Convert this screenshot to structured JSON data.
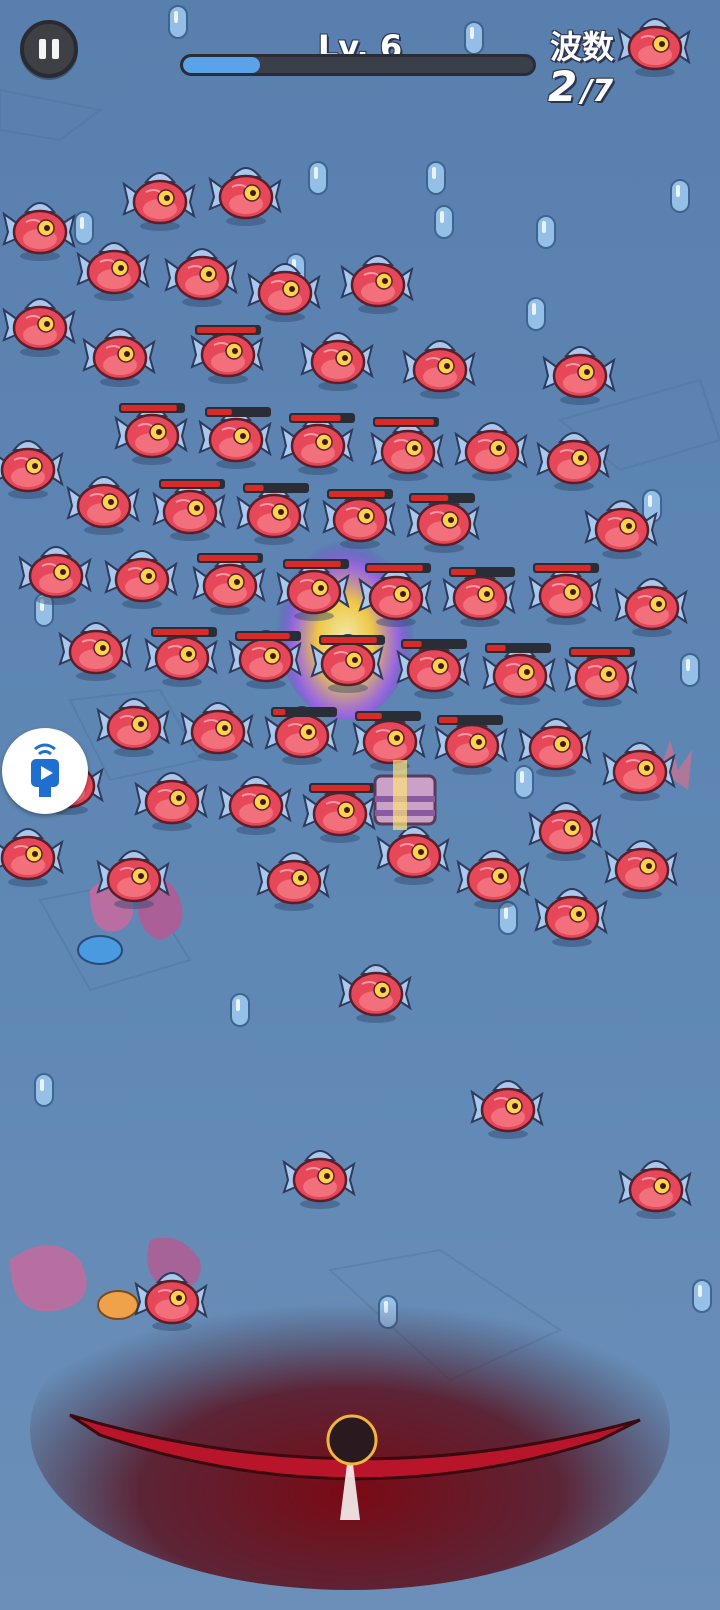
{
  "hud": {
    "level_label": "Lv. 6",
    "level_progress": 0.22,
    "wave_title": "波数",
    "wave_current": "2",
    "wave_total": "/7"
  },
  "icons": {
    "pause": "pause-icon",
    "side_button": "video-ad-icon",
    "player": "player-bow-icon",
    "chest": "treasure-chest-icon"
  },
  "colors": {
    "water": "#5e84b0",
    "fish_body": "#e6485a",
    "fish_fin": "#a9c8ee",
    "xp_fill": "#5aa3ea",
    "health_bar": "#d92a2a",
    "player_glow": "#c0142a"
  },
  "enemies": {
    "name": "red-pufferfish",
    "count": 66
  }
}
